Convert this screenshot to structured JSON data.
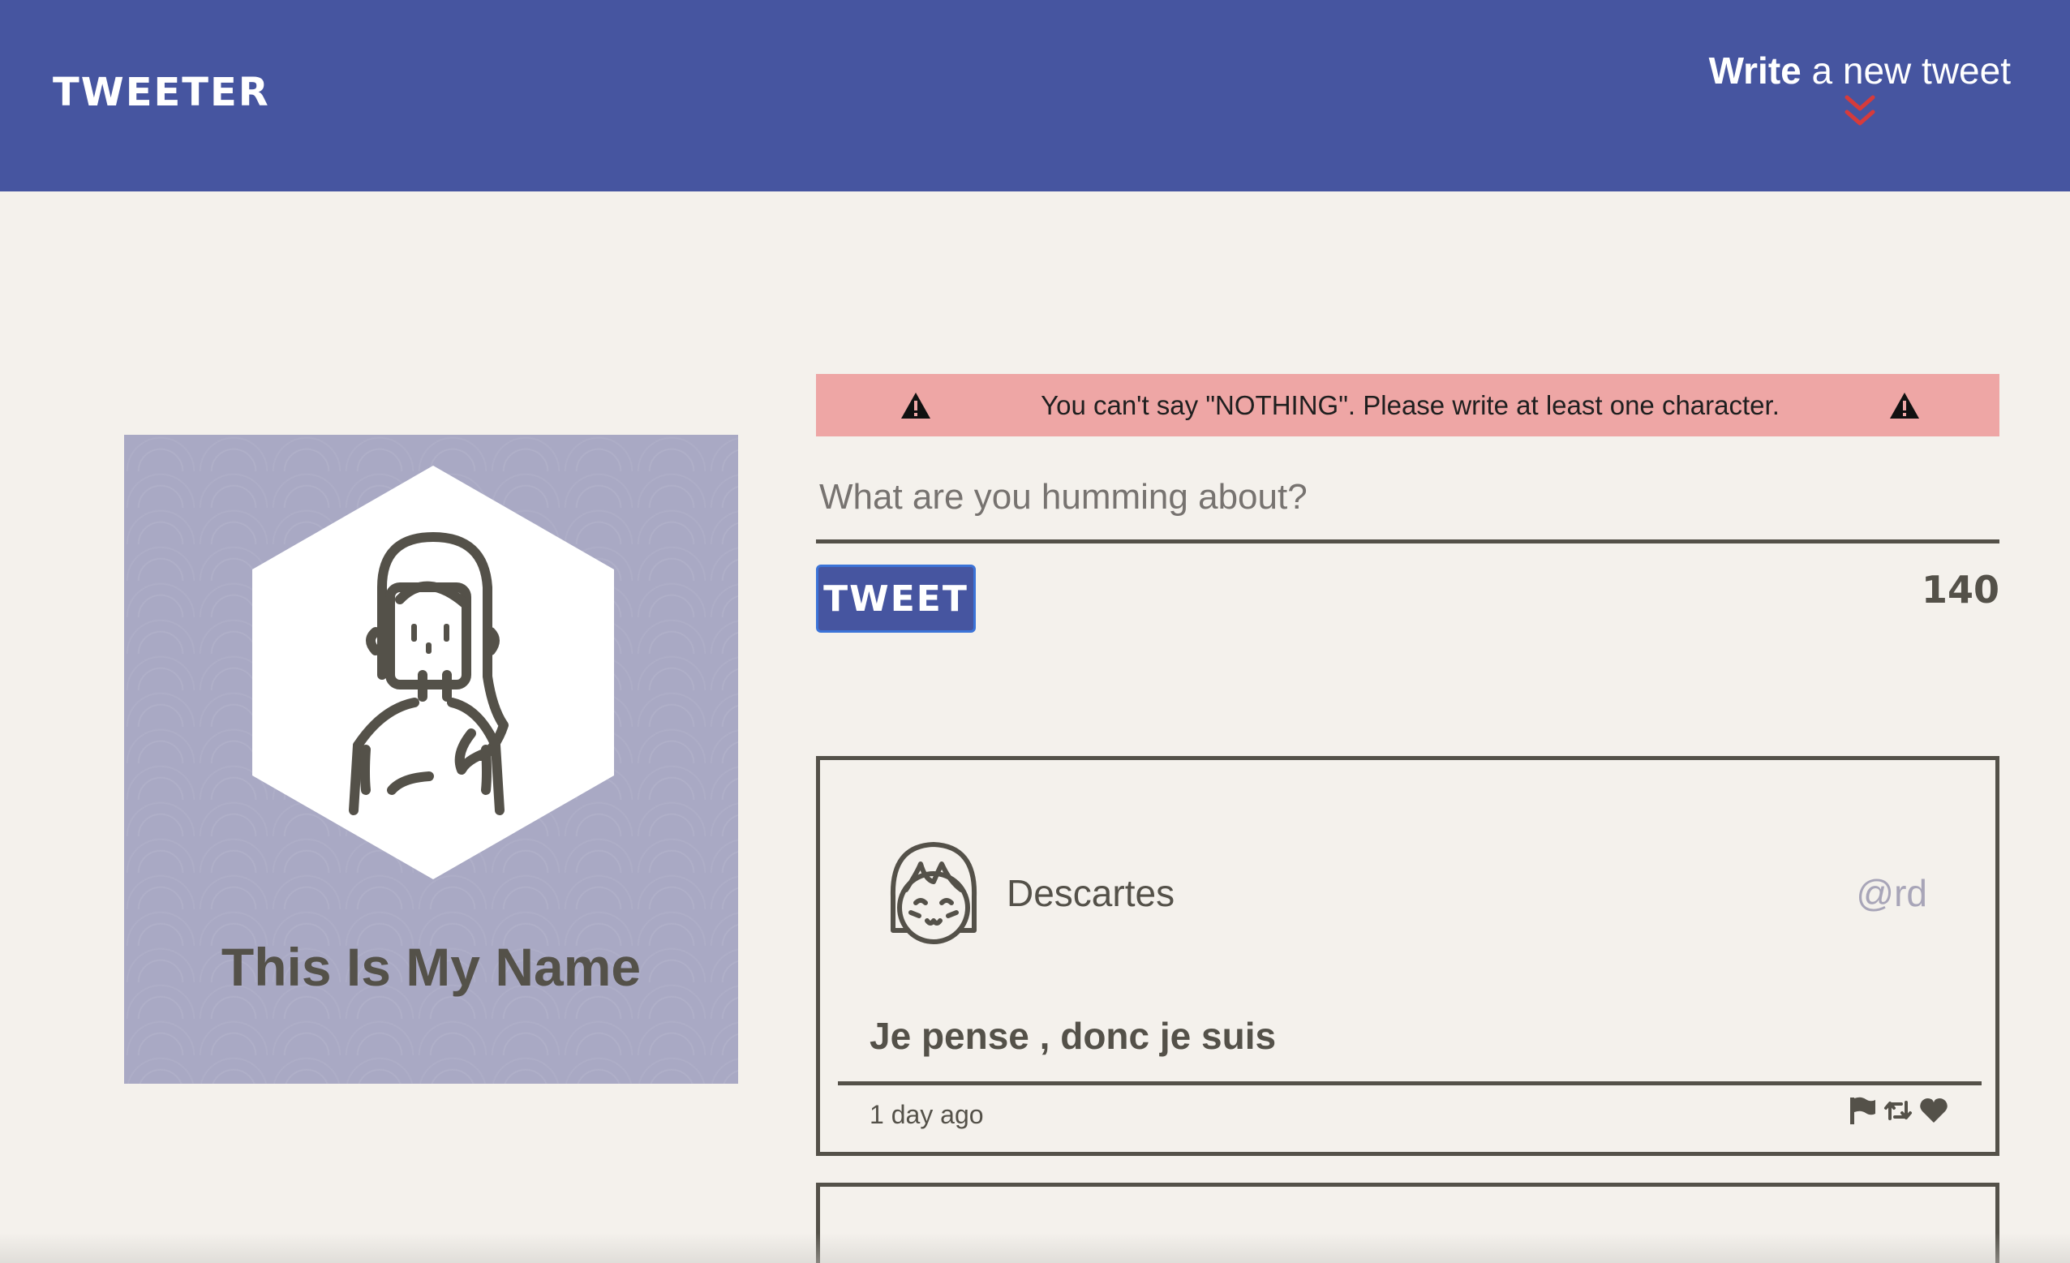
{
  "header": {
    "brand": "TWEETER",
    "compose_strong": "Write",
    "compose_rest": " a new tweet",
    "compose_icon": "double-chevron-down-icon",
    "compose_icon_color": "#d63b3b"
  },
  "profile": {
    "name": "This Is My Name",
    "avatar_icon": "woman-avatar-icon"
  },
  "composer": {
    "error_message": "You can't say \"NOTHING\". Please write at least one character.",
    "error_icon": "warning-triangle-icon",
    "placeholder": "What are you humming about?",
    "value": "",
    "submit_label": "TWEET",
    "char_counter": "140"
  },
  "tweets": [
    {
      "author": "Descartes",
      "handle": "@rd",
      "content": "Je pense , donc je suis",
      "timestamp": "1 day ago",
      "avatar_icon": "girl-avatar-icon",
      "actions": [
        "flag-icon",
        "retweet-icon",
        "heart-icon"
      ]
    }
  ],
  "colors": {
    "navbar": "#4655a0",
    "page_background": "#f4f1ec",
    "profile_background": "#a9a9c4",
    "error_background": "#eea6a5",
    "text": "#545149",
    "handle": "#a8a5b8"
  }
}
